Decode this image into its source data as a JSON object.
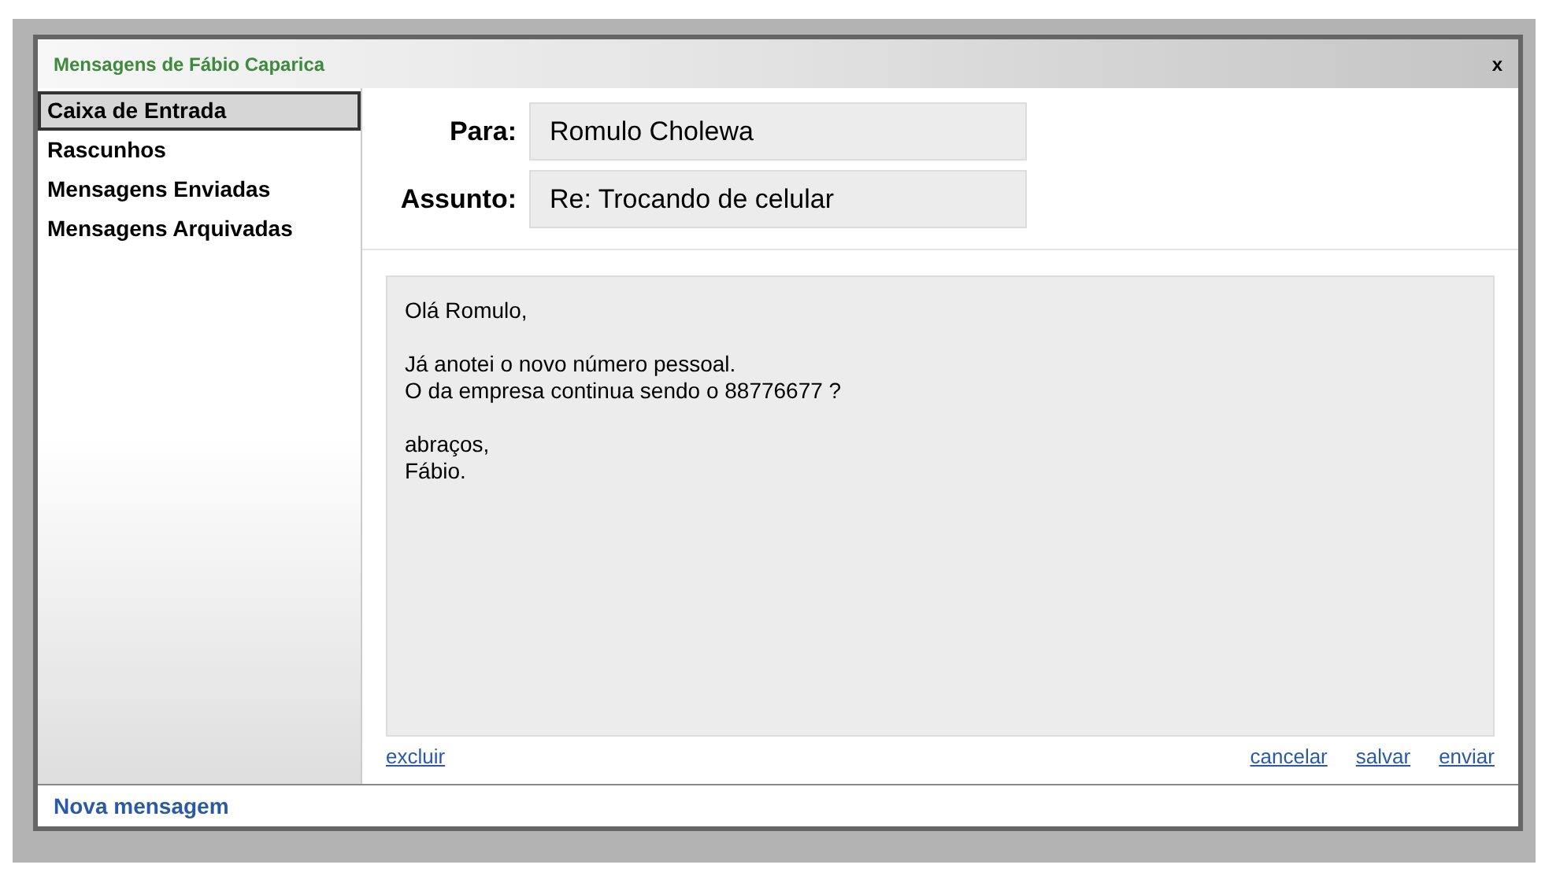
{
  "window": {
    "title": "Mensagens de Fábio Caparica",
    "close": "x"
  },
  "sidebar": {
    "items": [
      {
        "label": "Caixa de Entrada",
        "selected": true
      },
      {
        "label": "Rascunhos",
        "selected": false
      },
      {
        "label": "Mensagens Enviadas",
        "selected": false
      },
      {
        "label": "Mensagens Arquivadas",
        "selected": false
      }
    ]
  },
  "fields": [
    {
      "label": "Para:",
      "value": "Romulo Cholewa"
    },
    {
      "label": "Assunto:",
      "value": "Re: Trocando de celular"
    }
  ],
  "body": [
    [
      "Olá Romulo,"
    ],
    [
      "Já anotei o novo número pessoal.",
      "O da empresa continua sendo o 88776677 ?"
    ],
    [
      "abraços,",
      "Fábio."
    ]
  ],
  "left_actions": [
    "excluir"
  ],
  "right_actions": [
    "cancelar",
    "salvar",
    "enviar"
  ],
  "footer_link": "Nova mensagem"
}
